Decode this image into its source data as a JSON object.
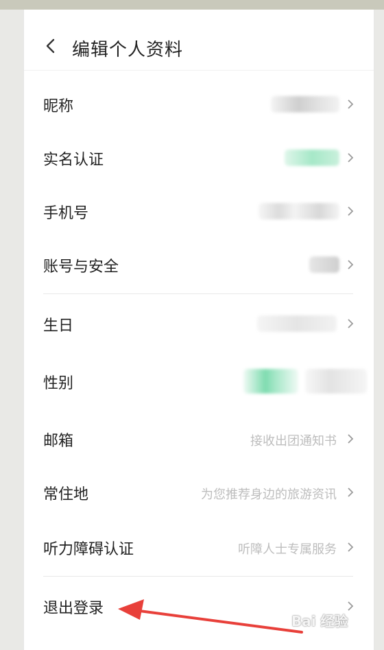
{
  "header": {
    "title": "编辑个人资料"
  },
  "rows": [
    {
      "label": "昵称",
      "value": ""
    },
    {
      "label": "实名认证",
      "value": ""
    },
    {
      "label": "手机号",
      "value": ""
    },
    {
      "label": "账号与安全",
      "value": ""
    },
    {
      "label": "生日",
      "value": ""
    },
    {
      "label": "性别",
      "value": ""
    },
    {
      "label": "邮箱",
      "value": "接收出团通知书"
    },
    {
      "label": "常住地",
      "value": "为您推荐身边的旅游资讯"
    },
    {
      "label": "听力障碍认证",
      "value": "听障人士专属服务"
    }
  ],
  "logout": {
    "label": "退出登录"
  },
  "watermark": {
    "text": "Bai 经验"
  },
  "colors": {
    "annotation_arrow": "#e8403a",
    "accent_green": "#7fdcb0",
    "placeholder_text": "#bdbdbd"
  }
}
